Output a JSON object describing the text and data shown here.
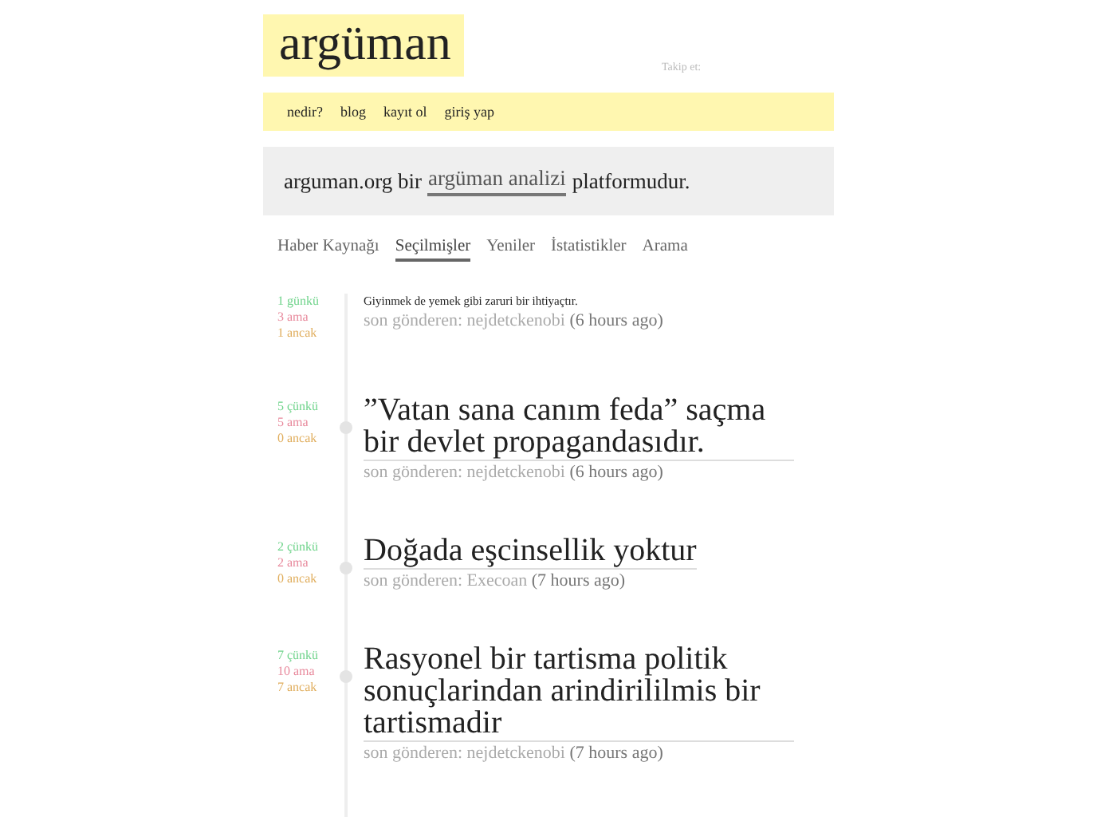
{
  "logo": "argüman",
  "follow": "Takip et:",
  "nav": [
    "nedir?",
    "blog",
    "kayıt ol",
    "giriş yap"
  ],
  "intro": {
    "before": "arguman.org bir",
    "link": "argüman analizi",
    "after": "platformudur."
  },
  "tabs": [
    {
      "label": "Haber Kaynağı",
      "selected": false
    },
    {
      "label": "Seçilmişler",
      "selected": true
    },
    {
      "label": "Yeniler",
      "selected": false
    },
    {
      "label": "İstatistikler",
      "selected": false
    },
    {
      "label": "Arama",
      "selected": false
    }
  ],
  "arguments": [
    {
      "kind": "small",
      "title": "Giyinmek de yemek gibi zaruri bir ihtiyaçtır.",
      "counts": [
        "1 günkü",
        "3 ama",
        "1 ancak"
      ],
      "label": "son gönderen:",
      "user": "nejdetckenobi",
      "time": "(6 hours ago)"
    },
    {
      "kind": "large",
      "title": "”Vatan sana canım feda” saçma bir devlet propagandasıdır.",
      "counts": [
        "5 çünkü",
        "5 ama",
        "0 ancak"
      ],
      "label": "son gönderen:",
      "user": "nejdetckenobi",
      "time": "(6 hours ago)"
    },
    {
      "kind": "large",
      "title": "Doğada eşcinsellik yoktur",
      "counts": [
        "2 çünkü",
        "2 ama",
        "0 ancak"
      ],
      "label": "son gönderen:",
      "user": "Execoan",
      "time": "(7 hours ago)"
    },
    {
      "kind": "large",
      "title": "Rasyonel bir tartisma politik sonuçlarindan arindirililmis bir tartismadir",
      "counts": [
        "7 çünkü",
        "10 ama",
        "7 ancak"
      ],
      "label": "son gönderen:",
      "user": "nejdetckenobi",
      "time": "(7 hours ago)"
    }
  ]
}
